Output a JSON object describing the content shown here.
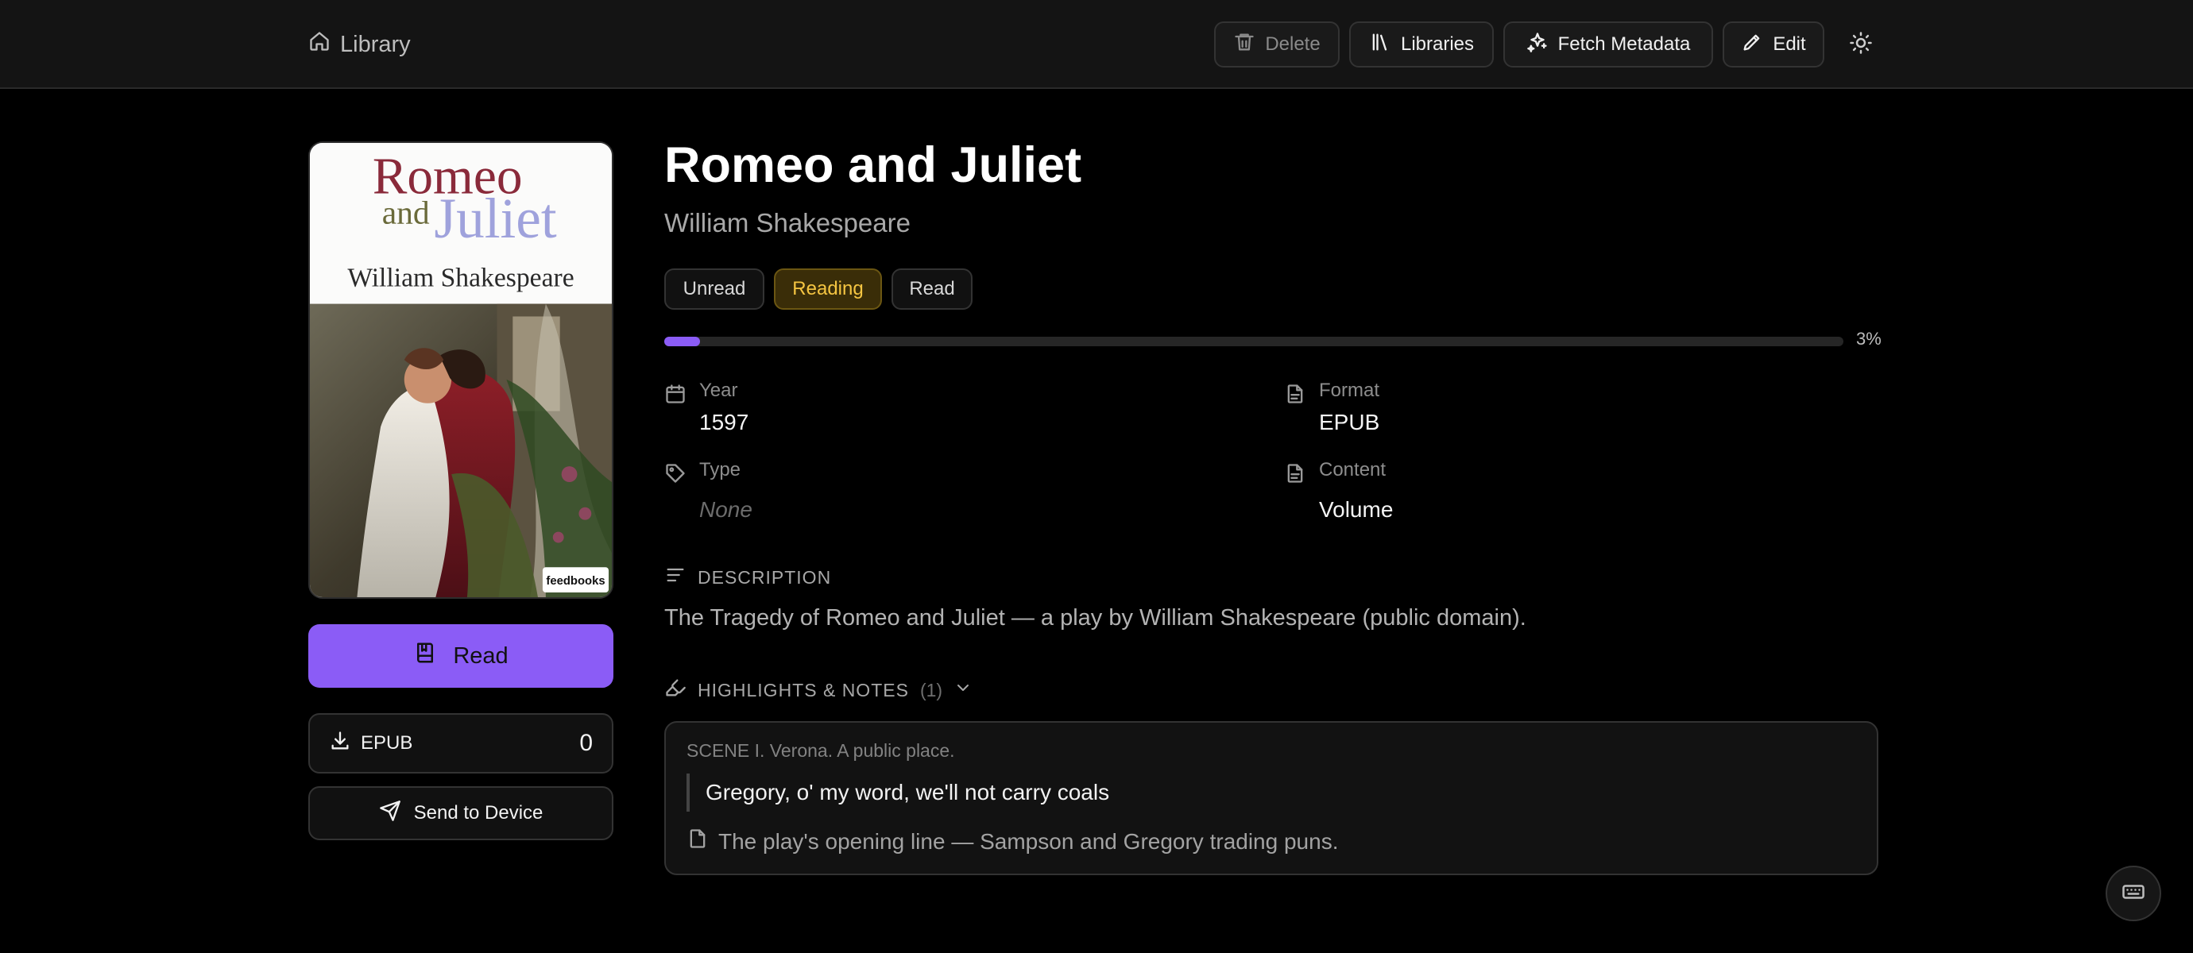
{
  "topbar": {
    "home_label": "Library",
    "delete_label": "Delete",
    "libraries_label": "Libraries",
    "fetch_label": "Fetch Metadata",
    "edit_label": "Edit"
  },
  "cover": {
    "title_line1": "Romeo",
    "title_and": "and",
    "title_line2": "Juliet",
    "author": "William Shakespeare",
    "publisher": "feedbooks"
  },
  "book": {
    "title": "Romeo and Juliet",
    "author": "William Shakespeare",
    "status_options": [
      "Unread",
      "Reading",
      "Read"
    ],
    "status_selected": "Reading",
    "progress_percent": 3,
    "progress_label": "3%"
  },
  "metadata": {
    "year_label": "Year",
    "year_value": "1597",
    "format_label": "Format",
    "format_value": "EPUB",
    "type_label": "Type",
    "type_value": "None",
    "content_label": "Content",
    "content_value": "Volume"
  },
  "actions": {
    "read_label": "Read",
    "download_format": "EPUB",
    "download_count": "0",
    "send_label": "Send to Device"
  },
  "description": {
    "heading": "DESCRIPTION",
    "text": "The Tragedy of Romeo and Juliet — a play by William Shakespeare (public domain)."
  },
  "highlights": {
    "heading": "HIGHLIGHTS & NOTES",
    "count": "(1)",
    "items": [
      {
        "location": "SCENE I. Verona. A public place.",
        "quote": "Gregory, o' my word, we'll not carry coals",
        "note": "The play's opening line — Sampson and Gregory trading puns."
      }
    ]
  },
  "colors": {
    "accent": "#8b5cf6",
    "reading_badge": "#f5c542",
    "background": "#000000",
    "topbar": "#141414"
  },
  "icons": {
    "home": "home-icon",
    "delete": "trash-icon",
    "libraries": "libraries-icon",
    "fetch": "sparkles-icon",
    "edit": "pencil-icon",
    "theme": "sun-icon",
    "year": "calendar-icon",
    "format": "file-icon",
    "type": "tag-icon",
    "content": "file-icon",
    "description": "align-left-icon",
    "highlights": "highlighter-icon",
    "read": "book-icon",
    "download": "download-icon",
    "send": "send-icon",
    "note": "note-icon",
    "keyboard": "keyboard-icon"
  }
}
